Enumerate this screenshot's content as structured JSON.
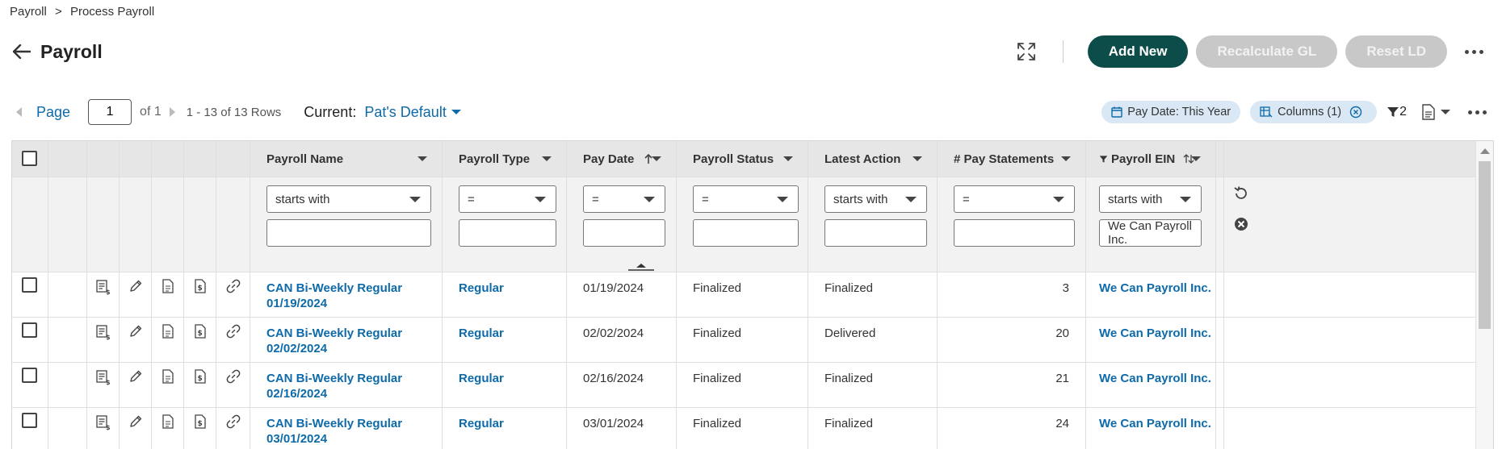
{
  "breadcrumb": {
    "root": "Payroll",
    "separator": ">",
    "current": "Process Payroll"
  },
  "title": "Payroll",
  "actions": {
    "add_new": "Add New",
    "recalculate_gl": "Recalculate GL",
    "reset_ld": "Reset LD"
  },
  "pager": {
    "page_label": "Page",
    "page_value": "1",
    "of_text": "of 1",
    "rows_text": "1 - 13 of 13 Rows",
    "current_label": "Current:",
    "current_view": "Pat's Default"
  },
  "filter_chips": {
    "pay_date": "Pay Date: This Year",
    "columns": "Columns (1)",
    "filter_count": "2"
  },
  "columns": {
    "payroll_name": "Payroll Name",
    "payroll_type": "Payroll Type",
    "pay_date": "Pay Date",
    "payroll_status": "Payroll Status",
    "latest_action": "Latest Action",
    "pay_statements": "# Pay Statements",
    "payroll_ein": "Payroll EIN"
  },
  "filters": {
    "payroll_name_op": "starts with",
    "payroll_type_op": "=",
    "pay_date_op": "=",
    "payroll_status_op": "=",
    "latest_action_op": "starts with",
    "pay_statements_op": "=",
    "payroll_ein_op": "starts with",
    "payroll_ein_value": "We Can Payroll Inc."
  },
  "rows": [
    {
      "name_line1": "CAN Bi-Weekly Regular",
      "name_line2": "01/19/2024",
      "type": "Regular",
      "pay_date": "01/19/2024",
      "status": "Finalized",
      "latest_action": "Finalized",
      "statements": "3",
      "ein": "We Can Payroll Inc."
    },
    {
      "name_line1": "CAN Bi-Weekly Regular",
      "name_line2": "02/02/2024",
      "type": "Regular",
      "pay_date": "02/02/2024",
      "status": "Finalized",
      "latest_action": "Delivered",
      "statements": "20",
      "ein": "We Can Payroll Inc."
    },
    {
      "name_line1": "CAN Bi-Weekly Regular",
      "name_line2": "02/16/2024",
      "type": "Regular",
      "pay_date": "02/16/2024",
      "status": "Finalized",
      "latest_action": "Finalized",
      "statements": "21",
      "ein": "We Can Payroll Inc."
    },
    {
      "name_line1": "CAN Bi-Weekly Regular",
      "name_line2": "03/01/2024",
      "type": "Regular",
      "pay_date": "03/01/2024",
      "status": "Finalized",
      "latest_action": "Finalized",
      "statements": "24",
      "ein": "We Can Payroll Inc."
    }
  ],
  "icons": {
    "back": "arrow-left-icon",
    "expand": "expand-icon",
    "more": "more-dots-icon",
    "calendar": "calendar-icon",
    "columns": "columns-icon",
    "clear": "clear-circle-icon",
    "filter": "funnel-icon",
    "export": "document-icon",
    "row_icons": [
      "payroll-statement-icon",
      "edit-pencil-icon",
      "document-icon",
      "dollar-document-icon",
      "link-icon"
    ]
  },
  "colors": {
    "primary": "#0c4d4a",
    "link": "#0e6aa8",
    "chip": "#d9e8f4",
    "disabled": "#c8c8c8"
  }
}
